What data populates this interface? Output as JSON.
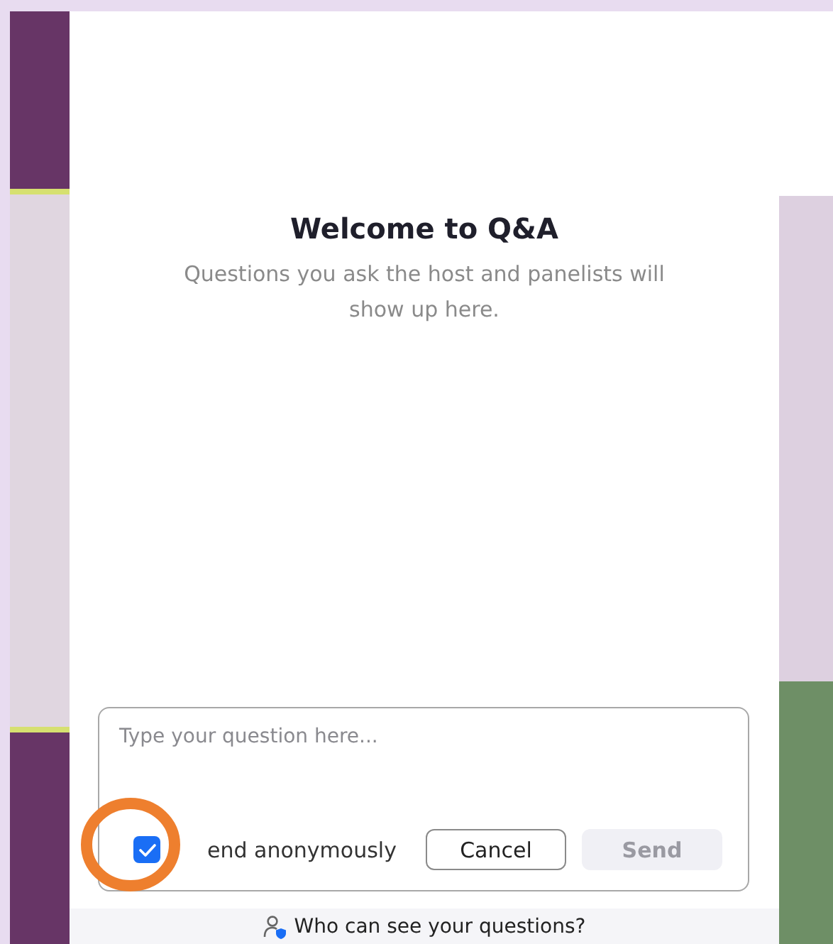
{
  "panel": {
    "title": "Welcome to Q&A",
    "subtitle": "Questions you ask the host and panelists will show up here."
  },
  "composer": {
    "placeholder": "Type your question here...",
    "anonymous": {
      "label": "end anonymously",
      "checked": true
    },
    "buttons": [
      {
        "label": "Cancel",
        "kind": "secondary",
        "disabled": false
      },
      {
        "label": "Send",
        "kind": "primary",
        "disabled": true
      }
    ]
  },
  "footer": {
    "label": "Who can see your questions?"
  }
}
